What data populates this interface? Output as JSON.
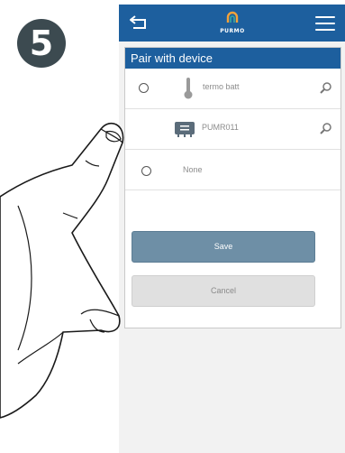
{
  "step": {
    "number": "5"
  },
  "topbar": {
    "back_icon": "back-arrow-icon",
    "logo_text": "PURMO",
    "menu_icon": "hamburger-menu-icon",
    "background": "#1d5f9e"
  },
  "panel": {
    "title": "Pair with device"
  },
  "devices": [
    {
      "label": "termo batt",
      "icon": "thermometer-icon",
      "has_radio": true,
      "zoom_icon": "magnifier-icon"
    },
    {
      "label": "PUMR011",
      "icon": "receiver-icon",
      "has_radio": true,
      "zoom_icon": "magnifier-icon"
    },
    {
      "label": "None",
      "has_radio": true
    }
  ],
  "buttons": {
    "save_label": "Save",
    "cancel_label": "Cancel",
    "save_color": "#6e8fa6",
    "cancel_color": "#e0e0e0"
  },
  "illustration": {
    "hand": "pointing-hand"
  }
}
